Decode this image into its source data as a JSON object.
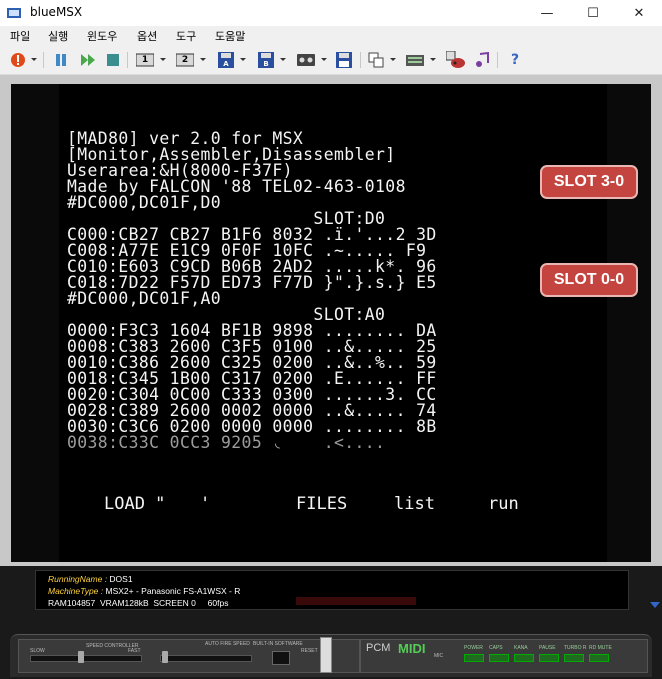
{
  "window": {
    "title": "blueMSX",
    "minimize": "—",
    "maximize": "☐",
    "close": "✕"
  },
  "menu": [
    "파일",
    "실행",
    "윈도우",
    "옵션",
    "도구",
    "도움말"
  ],
  "toolbar": {
    "icons": [
      "run-icon",
      "pause-icon",
      "fast-forward-icon",
      "stop-icon",
      "cart1-icon",
      "cart2-icon",
      "disk-a-icon",
      "disk-b-icon",
      "tape-icon",
      "disk-save-icon",
      "copy-window-icon",
      "keyboard-icon",
      "game-icon",
      "music-icon",
      "help-icon"
    ],
    "labels": {
      "cart1": "1",
      "cart2": "2",
      "diskA": "A",
      "diskB": "B",
      "help": "?"
    }
  },
  "screen": {
    "lines": [
      "[MAD80] ver 2.0 for MSX",
      "[Monitor,Assembler,Disassembler]",
      "Userarea:&H(8000-F37F)",
      "Made by FALCON '88 TEL02-463-0108",
      "#DC000,DC01F,D0",
      "                        SLOT:D0",
      "C000:CB27 CB27 B1F6 8032 .ï.'...2 3D",
      "C008:A77E E1C9 0F0F 10FC .~..... F9",
      "C010:E603 C9CD B06B 2AD2 .....k*. 96",
      "C018:7D22 F57D ED73 F77D }\".}.s.} E5",
      "#DC000,DC01F,A0",
      "                        SLOT:A0",
      "0000:F3C3 1604 BF1B 9898 ........ DA",
      "0008:C383 2600 C3F5 0100 ..&..... 25",
      "0010:C386 2600 C325 0200 ..&..%.. 59",
      "0018:C345 1B00 C317 0200 .E...... FF",
      "0020:C304 0C00 C333 0300 ......3. CC",
      "0028:C389 2600 0002 0000 ..&..... 74",
      "0030:C3C6 0200 0000 0000 ........ 8B",
      "0038:C33C 0CC3 9205 ◟    .<...."
    ],
    "function_keys": [
      "LOAD \"",
      "'",
      "FILES",
      "list",
      "run"
    ]
  },
  "annotations": [
    "SLOT 3-0",
    "SLOT 0-0"
  ],
  "status": {
    "running_label": "RunningName : ",
    "running_value": "DOS1",
    "machine_label": "MachineType : ",
    "machine_value": "MSX2+ - Panasonic FS-A1WSX - R",
    "stats": "RAM104857  VRAM128kB  SCREEN 0     60fps"
  },
  "console": {
    "labels": [
      "SLOW",
      "SPEED CONTROLLER",
      "FAST",
      "AUTO FIRE SPEED",
      "BUILT-IN SOFTWARE",
      "RESET",
      "PCM",
      "MIDI",
      "MIC"
    ],
    "leds": [
      "POWER",
      "CAPS",
      "KANA",
      "PAUSE",
      "TURBO R",
      "RD MUTE"
    ]
  }
}
